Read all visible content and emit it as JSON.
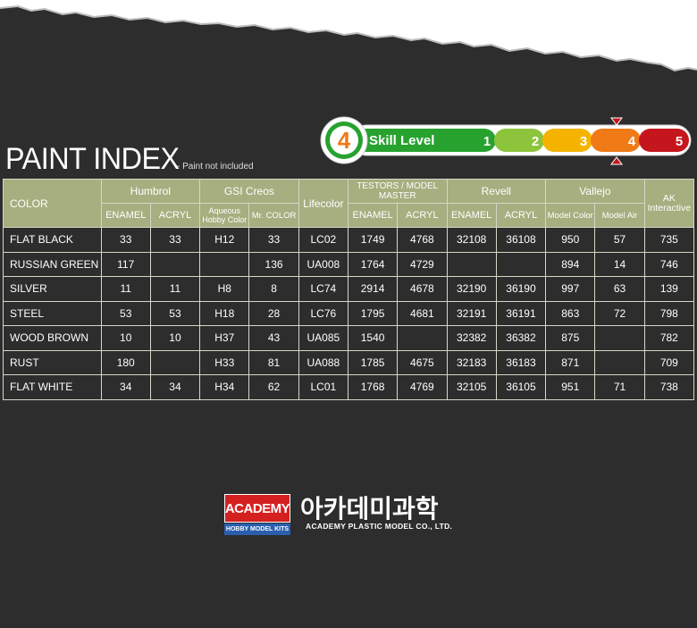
{
  "header": {
    "title": "PAINT INDEX",
    "note": "- Paint not included"
  },
  "skill": {
    "number": "4",
    "label": "Skill Level",
    "levels": [
      "1",
      "2",
      "3",
      "4",
      "5"
    ],
    "current_level": 4,
    "colors": [
      "#27a22f",
      "#8cc43c",
      "#f5b300",
      "#f07a16",
      "#c4161c"
    ]
  },
  "table": {
    "color_header": "COLOR",
    "brands": {
      "humbrol": "Humbrol",
      "gsi": "GSI Creos",
      "lifecolor": "Lifecolor",
      "testors": "TESTORS / MODEL MASTER",
      "revell": "Revell",
      "vallejo": "Vallejo",
      "ak": "AK Interactive"
    },
    "subheaders": {
      "humbrol_enamel": "ENAMEL",
      "humbrol_acryl": "ACRYL",
      "gsi_aqueous": "Aqueous Hobby Color",
      "gsi_mr": "Mr. COLOR",
      "testors_enamel": "ENAMEL",
      "testors_acryl": "ACRYL",
      "revell_enamel": "ENAMEL",
      "revell_acryl": "ACRYL",
      "vallejo_model_color": "Model Color",
      "vallejo_model_air": "Model Air"
    },
    "rows": [
      {
        "color": "FLAT BLACK",
        "h_enamel": "33",
        "h_acryl": "33",
        "gsi_aq": "H12",
        "gsi_mr": "33",
        "lifecolor": "LC02",
        "t_enamel": "1749",
        "t_acryl": "4768",
        "r_enamel": "32108",
        "r_acryl": "36108",
        "v_mc": "950",
        "v_ma": "57",
        "ak": "735"
      },
      {
        "color": "RUSSIAN GREEN",
        "h_enamel": "117",
        "h_acryl": "",
        "gsi_aq": "",
        "gsi_mr": "136",
        "lifecolor": "UA008",
        "t_enamel": "1764",
        "t_acryl": "4729",
        "r_enamel": "",
        "r_acryl": "",
        "v_mc": "894",
        "v_ma": "14",
        "ak": "746"
      },
      {
        "color": "SILVER",
        "h_enamel": "11",
        "h_acryl": "11",
        "gsi_aq": "H8",
        "gsi_mr": "8",
        "lifecolor": "LC74",
        "t_enamel": "2914",
        "t_acryl": "4678",
        "r_enamel": "32190",
        "r_acryl": "36190",
        "v_mc": "997",
        "v_ma": "63",
        "ak": "139"
      },
      {
        "color": "STEEL",
        "h_enamel": "53",
        "h_acryl": "53",
        "gsi_aq": "H18",
        "gsi_mr": "28",
        "lifecolor": "LC76",
        "t_enamel": "1795",
        "t_acryl": "4681",
        "r_enamel": "32191",
        "r_acryl": "36191",
        "v_mc": "863",
        "v_ma": "72",
        "ak": "798"
      },
      {
        "color": "WOOD BROWN",
        "h_enamel": "10",
        "h_acryl": "10",
        "gsi_aq": "H37",
        "gsi_mr": "43",
        "lifecolor": "UA085",
        "t_enamel": "1540",
        "t_acryl": "",
        "r_enamel": "32382",
        "r_acryl": "36382",
        "v_mc": "875",
        "v_ma": "",
        "ak": "782"
      },
      {
        "color": "RUST",
        "h_enamel": "180",
        "h_acryl": "",
        "gsi_aq": "H33",
        "gsi_mr": "81",
        "lifecolor": "UA088",
        "t_enamel": "1785",
        "t_acryl": "4675",
        "r_enamel": "32183",
        "r_acryl": "36183",
        "v_mc": "871",
        "v_ma": "",
        "ak": "709"
      },
      {
        "color": "FLAT WHITE",
        "h_enamel": "34",
        "h_acryl": "34",
        "gsi_aq": "H34",
        "gsi_mr": "62",
        "lifecolor": "LC01",
        "t_enamel": "1768",
        "t_acryl": "4769",
        "r_enamel": "32105",
        "r_acryl": "36105",
        "v_mc": "951",
        "v_ma": "71",
        "ak": "738"
      }
    ]
  },
  "brand": {
    "logo_top": "ACADEMY",
    "logo_bottom": "HOBBY MODEL KITS",
    "korean_name": "아카데미과학",
    "english_name": "ACADEMY PLASTIC MODEL CO., LTD."
  }
}
